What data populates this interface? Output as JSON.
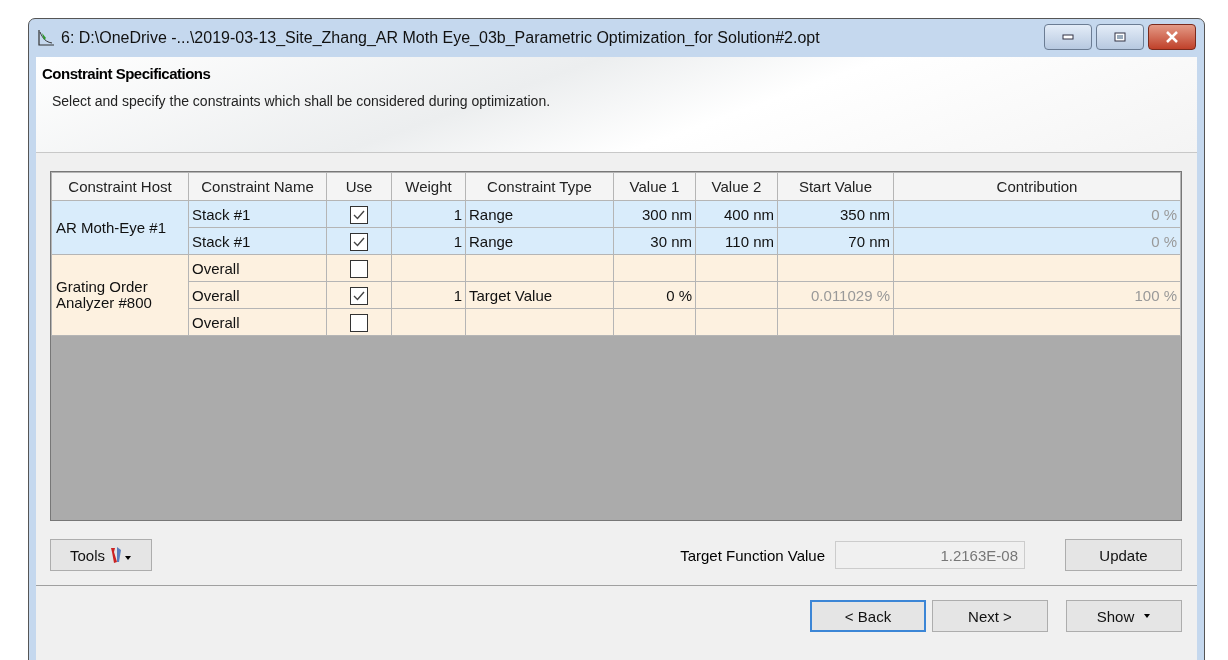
{
  "window": {
    "title": "6: D:\\OneDrive -...\\2019-03-13_Site_Zhang_AR Moth Eye_03b_Parametric Optimization_for Solution#2.opt"
  },
  "header": {
    "title": "Constraint Specifications",
    "description": "Select and specify the constraints which shall be considered during optimization."
  },
  "table": {
    "columns": [
      "Constraint Host",
      "Constraint Name",
      "Use",
      "Weight",
      "Constraint Type",
      "Value 1",
      "Value 2",
      "Start Value",
      "Contribution"
    ],
    "groups": [
      {
        "host": "AR Moth-Eye #1",
        "color": "#d9ecfb",
        "rows": [
          {
            "name": "Stack #1",
            "use": true,
            "weight": "1",
            "type": "Range",
            "value1": "300 nm",
            "value2": "400 nm",
            "start": "350 nm",
            "start_editable": true,
            "contribution": "0 %"
          },
          {
            "name": "Stack #1",
            "use": true,
            "weight": "1",
            "type": "Range",
            "value1": "30 nm",
            "value2": "110 nm",
            "start": "70 nm",
            "start_editable": true,
            "contribution": "0 %"
          }
        ]
      },
      {
        "host": "Grating Order Analyzer #800",
        "color": "#fdf1e0",
        "rows": [
          {
            "name": "Overall",
            "use": false
          },
          {
            "name": "Overall",
            "use": true,
            "weight": "1",
            "type": "Target Value",
            "value1": "0 %",
            "start": "0.011029 %",
            "start_editable": false,
            "contribution": "100 %"
          },
          {
            "name": "Overall",
            "use": false
          }
        ]
      }
    ]
  },
  "tools_button": "Tools",
  "target_function": {
    "label": "Target Function Value",
    "value": "1.2163E-08"
  },
  "update_button": "Update",
  "buttons": [
    {
      "label": "< Back",
      "default": true
    },
    {
      "label": "Next >",
      "default": false
    },
    {
      "label": "Show",
      "default": false,
      "dropdown": true
    }
  ]
}
